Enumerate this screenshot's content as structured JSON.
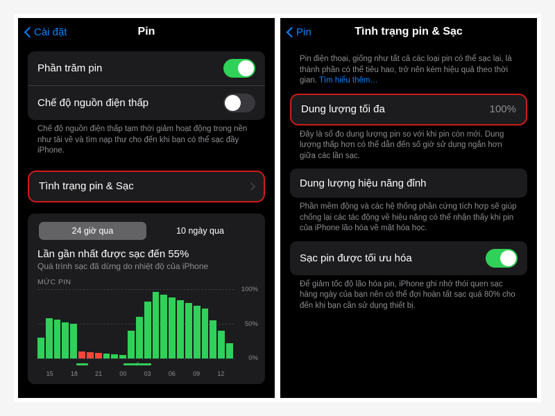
{
  "left": {
    "back_label": "Cài đặt",
    "title": "Pin",
    "rows": {
      "percent_label": "Phần trăm pin",
      "lowpower_label": "Chế độ nguồn điện thấp",
      "lowpower_toggle_on": false,
      "health_label": "Tình trạng pin & Sạc"
    },
    "lowpower_desc": "Chế độ nguồn điện thấp tạm thời giảm hoạt động trong nền như tải về và tìm nạp thư cho đến khi bạn có thể sạc đầy iPhone.",
    "segmented": {
      "a": "24 giờ qua",
      "b": "10 ngày qua"
    },
    "chart": {
      "title": "Lần gần nhất được sạc đến 55%",
      "sub": "Quá trình sạc đã dừng do nhiệt độ của iPhone",
      "section_label": "MỨC PIN"
    }
  },
  "right": {
    "back_label": "Pin",
    "title": "Tình trạng pin & Sạc",
    "intro_a": "Pin điện thoại, giống như tất cả các loại pin có thể sạc lại, là thành phần có thể tiêu hao, trở nên kém hiệu quả theo thời gian. ",
    "intro_link": "Tìm hiểu thêm…",
    "max_cap_label": "Dung lượng tối đa",
    "max_cap_value": "100%",
    "max_cap_desc": "Đây là số đo dung lượng pin so với khi pin còn mới. Dung lượng thấp hơn có thể dẫn đến số giờ sử dụng ngắn hơn giữa các lần sạc.",
    "peak_label": "Dung lượng hiệu năng đỉnh",
    "peak_desc": "Phần mềm động và các hệ thống phần cứng tích hợp sẽ giúp chống lại các tác động về hiệu năng có thể nhận thấy khi pin của iPhone lão hóa về mặt hóa học.",
    "opt_label": "Sạc pin được tối ưu hóa",
    "opt_desc": "Để giảm tốc độ lão hóa pin, iPhone ghi nhớ thói quen sạc hàng ngày của bạn nên có thể đợi hoàn tất sạc quá 80% cho đến khi bạn cần sử dụng thiết bị."
  },
  "chart_data": {
    "type": "bar",
    "title": "MỨC PIN",
    "ylabel": "",
    "ylim": [
      0,
      100
    ],
    "y_ticks": [
      0,
      50,
      100
    ],
    "x_ticks": [
      "15",
      "18",
      "21",
      "00",
      "03",
      "06",
      "09",
      "12"
    ],
    "series": [
      {
        "name": "level_dim",
        "values": [
          30,
          58,
          56,
          52,
          50,
          10,
          9,
          8,
          7,
          6,
          5,
          40,
          60,
          82,
          96,
          92,
          88,
          84,
          80,
          76,
          72,
          55,
          40,
          22
        ]
      },
      {
        "name": "level_green",
        "values": [
          30,
          58,
          56,
          52,
          50,
          10,
          9,
          8,
          7,
          6,
          5,
          40,
          60,
          82,
          96,
          92,
          88,
          84,
          80,
          76,
          72,
          55,
          40,
          22
        ]
      },
      {
        "name": "low_power",
        "values": [
          0,
          0,
          0,
          0,
          0,
          10,
          9,
          8,
          0,
          0,
          0,
          0,
          0,
          0,
          0,
          0,
          0,
          0,
          0,
          0,
          0,
          0,
          0,
          0
        ]
      }
    ],
    "charging_segments": [
      {
        "start_pct": 20,
        "width_pct": 6
      },
      {
        "start_pct": 44,
        "width_pct": 14
      }
    ],
    "bolt_at_pct": 50
  }
}
